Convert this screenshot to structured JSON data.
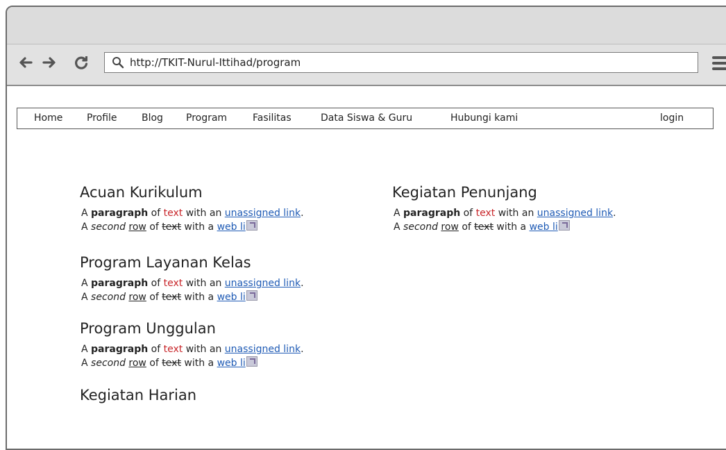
{
  "browser": {
    "back_icon": "back-arrow-icon",
    "forward_icon": "forward-arrow-icon",
    "reload_icon": "reload-icon",
    "url": "http://TKIT-Nurul-Ittihad/program",
    "menu_icon": "hamburger-menu-icon"
  },
  "nav": {
    "items": [
      "Home",
      "Profile",
      "Blog",
      "Program",
      "Fasilitas",
      "Data Siswa & Guru",
      "Hubungi kami"
    ],
    "login": "login"
  },
  "sample_text": {
    "a": "A",
    "paragraph": "paragraph",
    "of": "of",
    "text": "text",
    "with_an": "with an",
    "unassigned_link": "unassigned link",
    "period": ".",
    "second": "second",
    "row": "row",
    "with_a": "with a",
    "web_link": "web li"
  },
  "sections": {
    "left": [
      {
        "title": "Acuan Kurikulum"
      },
      {
        "title": "Program Layanan Kelas"
      },
      {
        "title": "Program Unggulan"
      },
      {
        "title": "Kegiatan Harian"
      }
    ],
    "right": [
      {
        "title": "Kegiatan Penunjang"
      }
    ]
  },
  "colors": {
    "red_text": "#c8262a",
    "link": "#1f5bb5"
  }
}
